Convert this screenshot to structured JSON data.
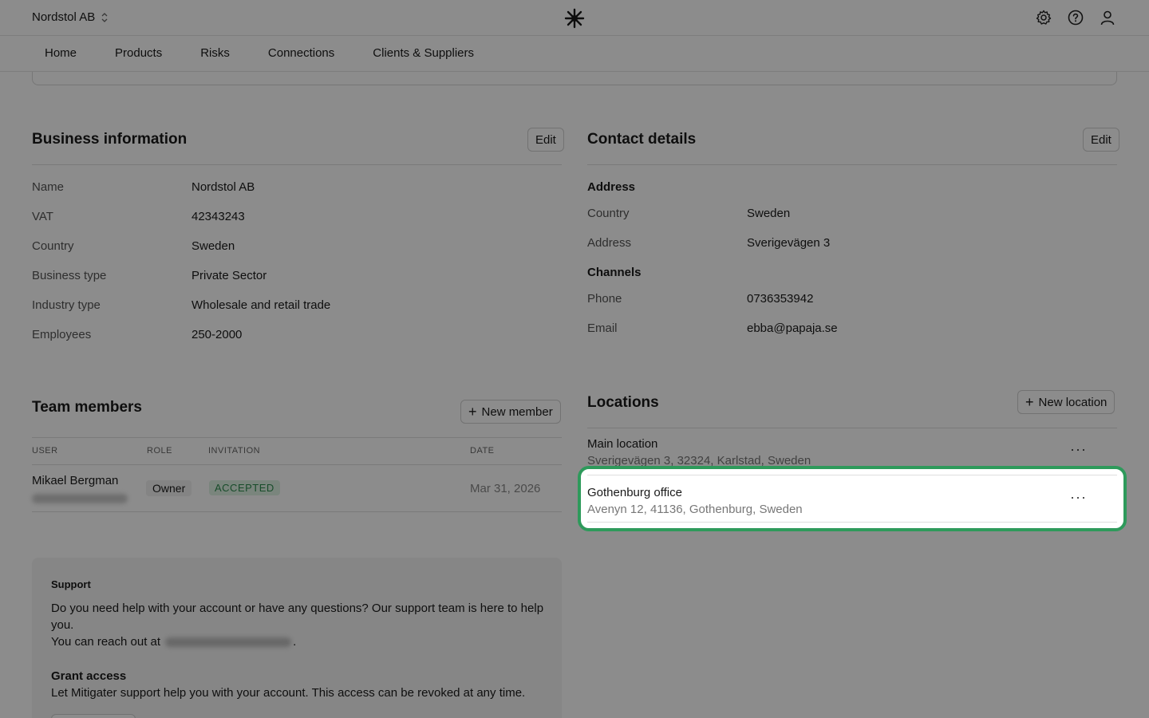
{
  "header": {
    "org_name": "Nordstol AB",
    "icons": [
      "settings-gear-icon",
      "help-icon",
      "user-icon"
    ]
  },
  "nav": {
    "tabs": [
      "Home",
      "Products",
      "Risks",
      "Connections",
      "Clients & Suppliers"
    ]
  },
  "business": {
    "title": "Business information",
    "edit_label": "Edit",
    "rows": [
      {
        "label": "Name",
        "value": "Nordstol AB"
      },
      {
        "label": "VAT",
        "value": "42343243"
      },
      {
        "label": "Country",
        "value": "Sweden"
      },
      {
        "label": "Business type",
        "value": "Private Sector"
      },
      {
        "label": "Industry type",
        "value": "Wholesale and retail trade"
      },
      {
        "label": "Employees",
        "value": "250-2000"
      }
    ]
  },
  "contact": {
    "title": "Contact details",
    "edit_label": "Edit",
    "address_heading": "Address",
    "country_label": "Country",
    "country_value": "Sweden",
    "address_label": "Address",
    "address_value": "Sverigevägen 3",
    "channels_heading": "Channels",
    "phone_label": "Phone",
    "phone_value": "0736353942",
    "email_label": "Email",
    "email_value": "ebba@papaja.se"
  },
  "team": {
    "title": "Team members",
    "new_label": "New member",
    "columns": [
      "USER",
      "ROLE",
      "INVITATION",
      "DATE"
    ],
    "members": [
      {
        "name": "Mikael Bergman",
        "role": "Owner",
        "invitation": "ACCEPTED",
        "date": "Mar 31, 2026"
      }
    ]
  },
  "locations": {
    "title": "Locations",
    "new_label": "New location",
    "items": [
      {
        "name": "Main location",
        "address": "Sverigevägen 3, 32324, Karlstad, Sweden"
      },
      {
        "name": "Gothenburg office",
        "address": "Avenyn 12, 41136, Gothenburg, Sweden"
      }
    ]
  },
  "support": {
    "title": "Support",
    "text": "Do you need help with your account or have any questions? Our support team is here to help you.",
    "reach_prefix": "You can reach out at",
    "reach_suffix": ".",
    "grant_title": "Grant access",
    "grant_text": "Let Mitigater support help you with your account. This access can be revoked at any time."
  },
  "colors": {
    "highlight": "#2e9a5b",
    "accepted_bg": "#dff3e4",
    "accepted_text": "#2d8a4e"
  }
}
